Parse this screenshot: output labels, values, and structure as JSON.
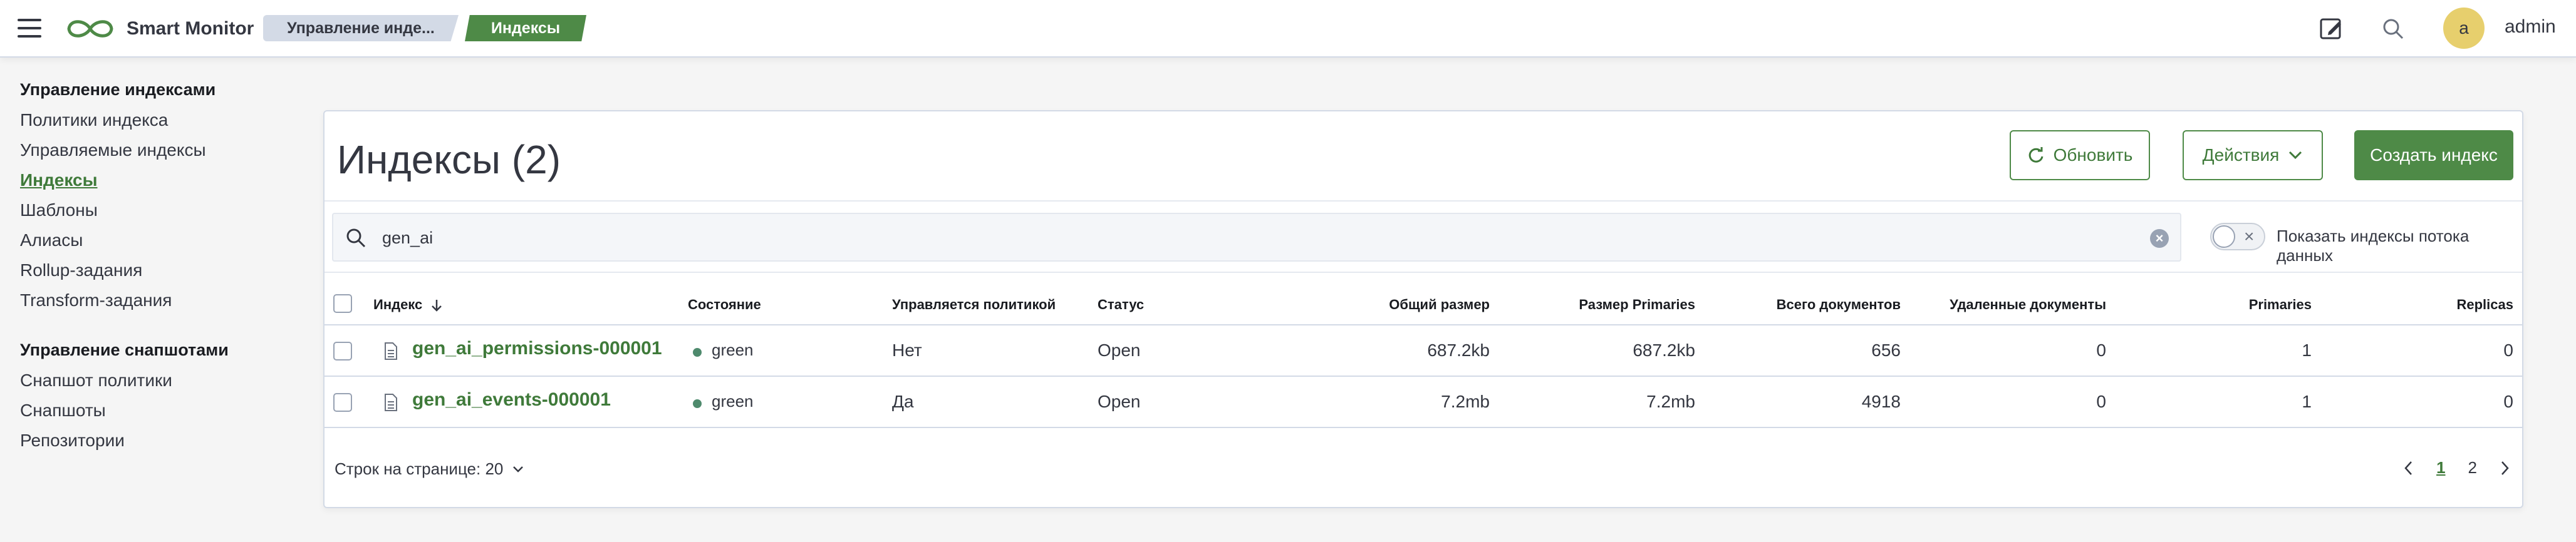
{
  "header": {
    "brand": "Smart Monitor",
    "breadcrumbs": [
      "Управление инде...",
      "Индексы"
    ],
    "avatar_initial": "a",
    "username": "admin"
  },
  "sidebar": {
    "group1_title": "Управление индексами",
    "group1_items": [
      "Политики индекса",
      "Управляемые индексы",
      "Индексы",
      "Шаблоны",
      "Алиасы",
      "Rollup-задания",
      "Transform-задания"
    ],
    "group2_title": "Управление снапшотами",
    "group2_items": [
      "Снапшот политики",
      "Снапшоты",
      "Репозитории"
    ]
  },
  "main": {
    "title": "Индексы (2)",
    "refresh_label": "Обновить",
    "actions_label": "Действия",
    "create_label": "Создать индекс",
    "search_value": "gen_ai",
    "toggle_label": "Показать индексы потока данных",
    "columns": [
      "Индекс",
      "Состояние",
      "Управляется политикой",
      "Статус",
      "Общий размер",
      "Размер Primaries",
      "Всего документов",
      "Удаленные документы",
      "Primaries",
      "Replicas"
    ],
    "rows": [
      {
        "index": "gen_ai_permissions-000001",
        "health": "green",
        "managed": "Нет",
        "status": "Open",
        "total_size": "687.2kb",
        "primaries_size": "687.2kb",
        "docs": "656",
        "deleted": "0",
        "primaries": "1",
        "replicas": "0"
      },
      {
        "index": "gen_ai_events-000001",
        "health": "green",
        "managed": "Да",
        "status": "Open",
        "total_size": "7.2mb",
        "primaries_size": "7.2mb",
        "docs": "4918",
        "deleted": "0",
        "primaries": "1",
        "replicas": "0"
      }
    ],
    "rows_per_page": "Строк на странице: 20",
    "pages": [
      "1",
      "2"
    ]
  },
  "colors": {
    "accent": "#4e8a47",
    "health_green": "#4e8a6d"
  }
}
